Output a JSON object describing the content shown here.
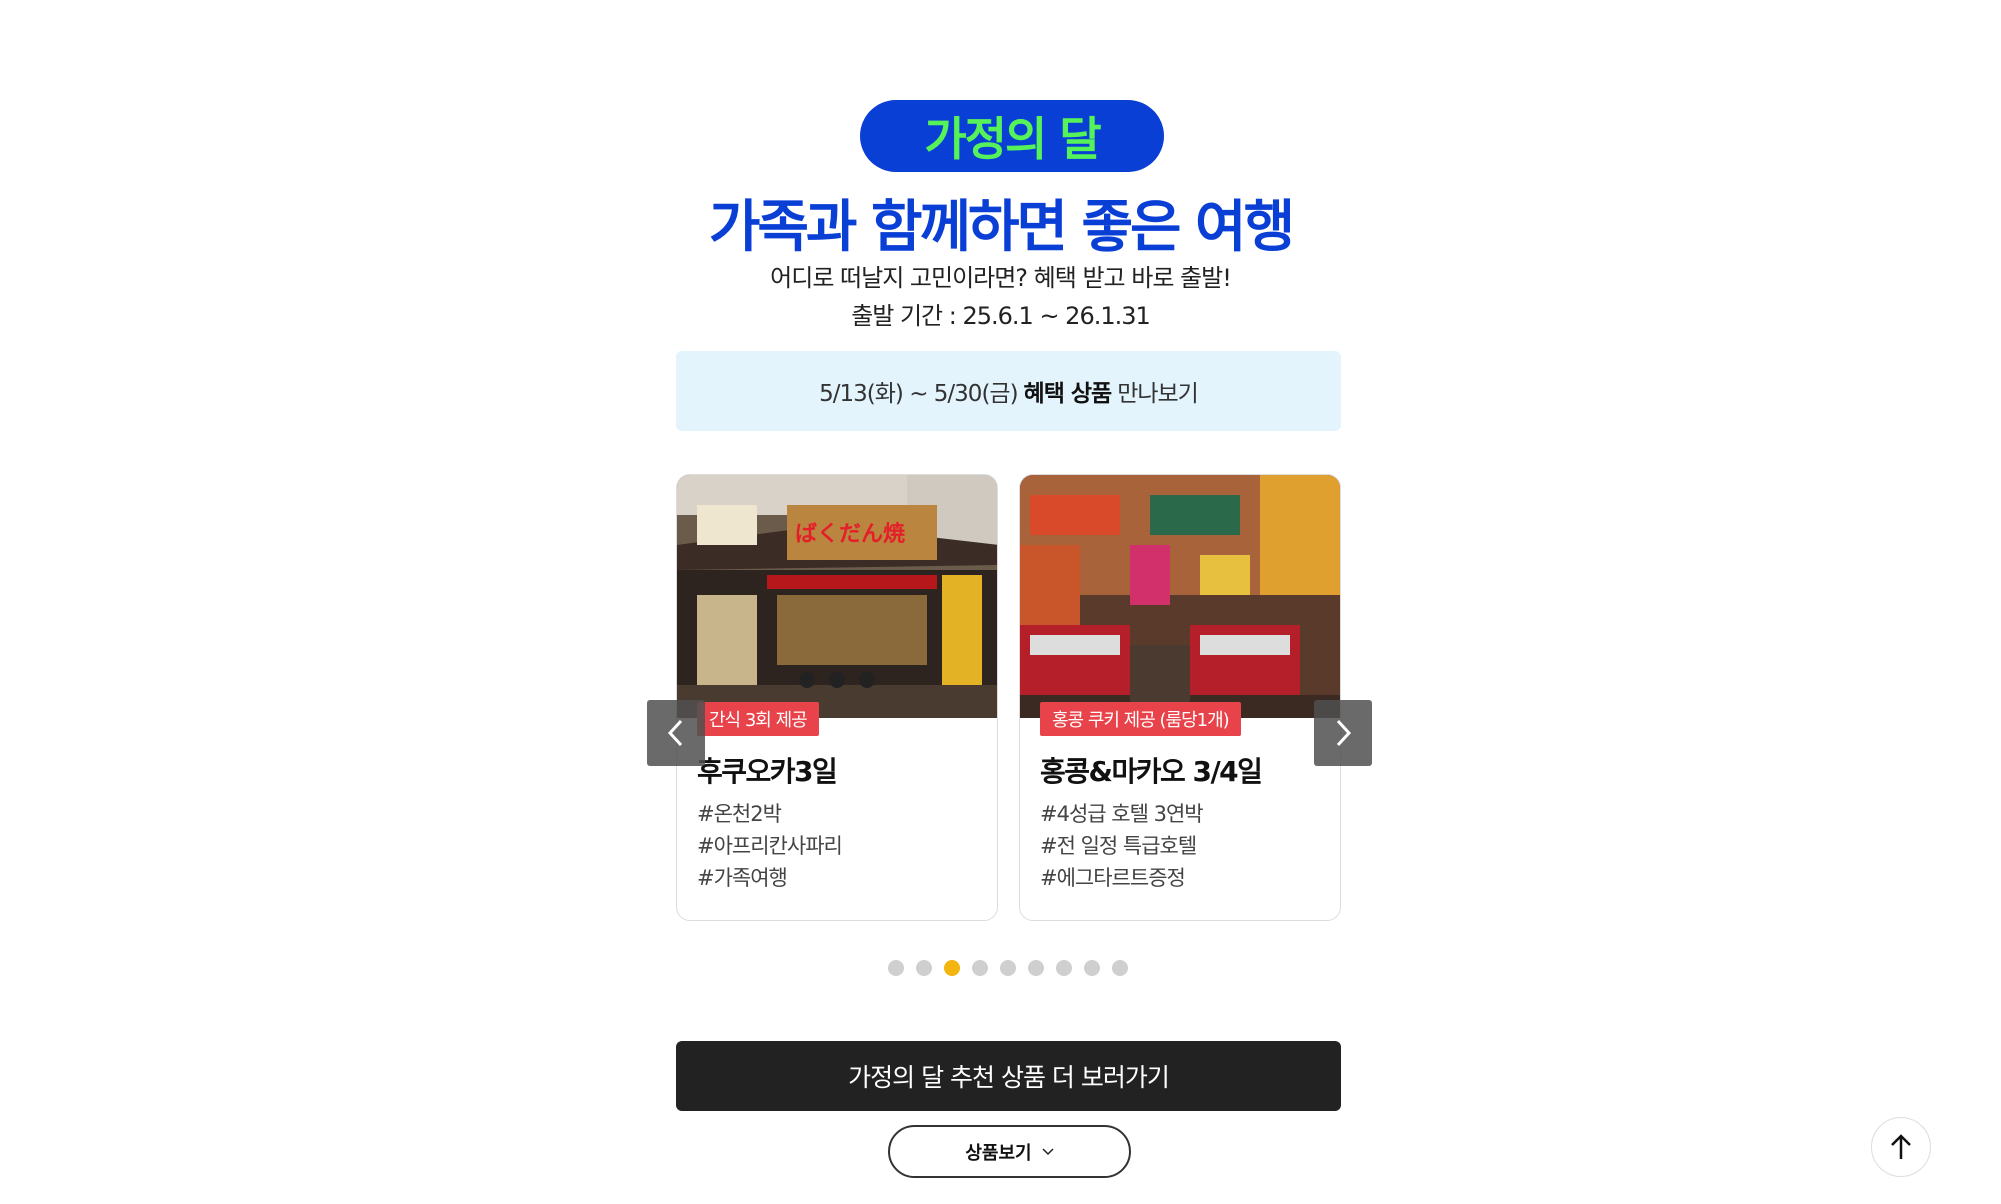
{
  "header": {
    "badge": "가정의 달",
    "headline": "가족과 함께하면 좋은 여행",
    "subtitle": "어디로 떠날지 고민이라면? 혜택 받고 바로 출발!",
    "period": "출발 기간 : 25.6.1 ~ 26.1.31"
  },
  "banner": {
    "date_range": "5/13(화) ~ 5/30(금)",
    "bold_text": "혜택 상품",
    "suffix": "만나보기"
  },
  "cards": [
    {
      "tag": "간식 3회 제공",
      "title": "후쿠오카3일",
      "hashtags": [
        "#온천2박",
        "#아프리칸사파리",
        "#가족여행"
      ]
    },
    {
      "tag": "홍콩 쿠키 제공 (룸당1개)",
      "title": "홍콩&마카오 3/4일",
      "hashtags": [
        "#4성급 호텔 3연박",
        "#전 일정 특급호텔",
        "#에그타르트증정"
      ]
    }
  ],
  "carousel": {
    "dot_count": 9,
    "active_index": 3,
    "active_color": "#f5b50f"
  },
  "cta": {
    "label": "가정의 달 추천 상품 더 보러가기"
  },
  "products_button": {
    "label": "상품보기"
  },
  "colors": {
    "brand_blue": "#0a3fd6",
    "badge_text": "#56f25a",
    "tag_red": "#e8434a",
    "banner_bg": "#e3f4fd"
  }
}
